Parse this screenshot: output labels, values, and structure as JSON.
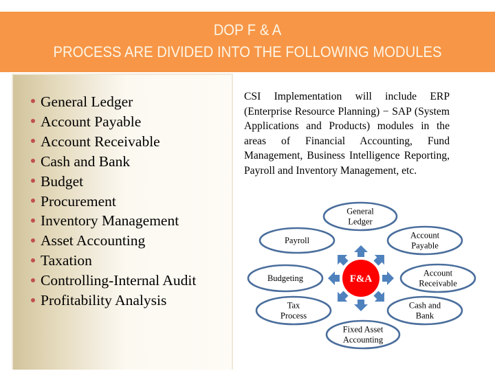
{
  "header": {
    "title_line1": "DOP  F & A",
    "title_line2": "PROCESS ARE DIVIDED INTO THE FOLLOWING MODULES"
  },
  "modules": [
    "General Ledger",
    "Account Payable",
    "Account Receivable",
    "Cash and Bank",
    "Budget",
    "Procurement",
    "Inventory Management",
    "Asset Accounting",
    "Taxation",
    "Controlling-Internal Audit",
    "Profitability Analysis"
  ],
  "description": "CSI Implementation will include ERP (Enterprise Resource Planning) − SAP (System Applications and Products) modules in the areas of Financial Accounting, Fund Management, Business Intelligence Reporting, Payroll and Inventory Management, etc.",
  "diagram": {
    "center_label": "F&A",
    "nodes": [
      {
        "id": "general-ledger",
        "lines": [
          "General",
          "Ledger"
        ]
      },
      {
        "id": "account-payable",
        "lines": [
          "Account",
          "Payable"
        ]
      },
      {
        "id": "account-receivable",
        "lines": [
          "Account",
          "Receivable"
        ]
      },
      {
        "id": "cash-and-bank",
        "lines": [
          "Cash and",
          "Bank"
        ]
      },
      {
        "id": "fixed-asset-accounting",
        "lines": [
          "Fixed Asset",
          "Accounting"
        ]
      },
      {
        "id": "tax-process",
        "lines": [
          "Tax",
          "Process"
        ]
      },
      {
        "id": "budgeting",
        "lines": [
          "Budgeting"
        ]
      },
      {
        "id": "payroll",
        "lines": [
          "Payroll"
        ]
      }
    ],
    "colors": {
      "center_fill": "#ff0000",
      "center_text": "#ffffff",
      "arrow": "#4f81bd",
      "ellipse_stroke": "#4a6e9c",
      "ellipse_fill": "#ffffff",
      "node_text": "#000000"
    }
  },
  "colors": {
    "header_bg": "#f79646",
    "header_text": "#fdf5e6",
    "bullet": "#c0504d"
  }
}
